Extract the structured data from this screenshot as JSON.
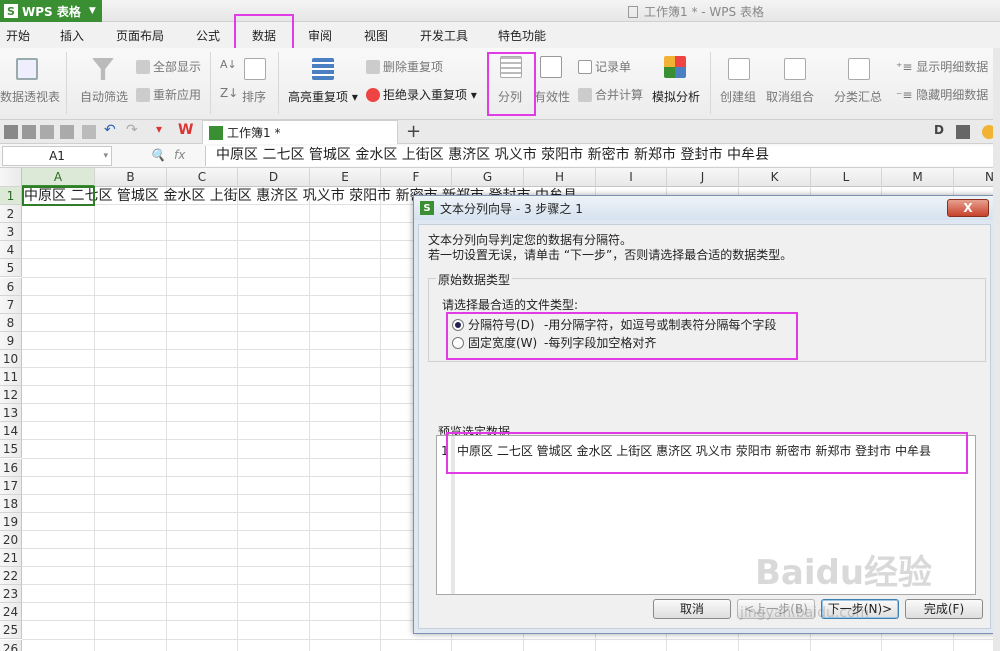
{
  "app": {
    "name": "WPS 表格",
    "window_title": "工作簿1 * - WPS 表格"
  },
  "menu": [
    "开始",
    "插入",
    "页面布局",
    "公式",
    "数据",
    "审阅",
    "视图",
    "开发工具",
    "特色功能"
  ],
  "ribbon": {
    "pivot": "数据透视表",
    "autofilter": "自动筛选",
    "show_all": "全部显示",
    "reapply": "重新应用",
    "sort": "排序",
    "highlight_dup": "高亮重复项",
    "remove_dup": "删除重复项",
    "reject_dup": "拒绝录入重复项",
    "split": "分列",
    "validity": "有效性",
    "record_form": "记录单",
    "consolidate": "合并计算",
    "whatif": "模拟分析",
    "group": "创建组",
    "ungroup": "取消组合",
    "subtotal": "分类汇总",
    "show_detail": "显示明细数据",
    "hide_detail": "隐藏明细数据"
  },
  "doc_tab": "工作簿1 *",
  "formula_bar": {
    "cell_ref": "A1",
    "fx": "fx",
    "content": "中原区 二七区 管城区 金水区 上街区 惠济区 巩义市 荥阳市 新密市 新郑市 登封市 中牟县"
  },
  "sheet": {
    "columns": [
      "A",
      "B",
      "C",
      "D",
      "E",
      "F",
      "G",
      "H",
      "I",
      "J",
      "K",
      "L",
      "M",
      "N"
    ],
    "rows": [
      "1",
      "2",
      "3",
      "4",
      "5",
      "6",
      "7",
      "8",
      "9",
      "10",
      "11",
      "12",
      "13",
      "14",
      "15",
      "16",
      "17",
      "18",
      "19",
      "20",
      "21",
      "22",
      "23",
      "24",
      "25",
      "26"
    ],
    "cell_a1": "中原区 二七区 管城区 金水区 上街区 惠济区 巩义市 荥阳市 新密市 新郑市 登封市 中牟县"
  },
  "dialog": {
    "title": "文本分列向导 - 3 步骤之 1",
    "close": "X",
    "intro1": "文本分列向导判定您的数据有分隔符。",
    "intro2": "若一切设置无误，请单击 “下一步”，否则请选择最合适的数据类型。",
    "group_label": "原始数据类型",
    "choose_label": "请选择最合适的文件类型:",
    "opt_delim": "分隔符号(D)",
    "opt_delim_desc": "-用分隔字符，如逗号或制表符分隔每个字段",
    "opt_fixed": "固定宽度(W)",
    "opt_fixed_desc": "-每列字段加空格对齐",
    "preview_label": "预览选定数据",
    "preview_rownum": "1",
    "preview_text": "中原区 二七区 管城区 金水区 上街区 惠济区 巩义市 荥阳市 新密市 新郑市 登封市 中牟县",
    "btn_cancel": "取消",
    "btn_prev": "<上一步(B)",
    "btn_next": "下一步(N)>",
    "btn_finish": "完成(F)"
  },
  "watermark": {
    "main": "Baidu经验",
    "sub": "jingyan.baidu.com"
  },
  "colors": {
    "wps_green": "#3a8f33",
    "highlight": "#e13be6",
    "dialog_bg": "#dfe8f2"
  }
}
